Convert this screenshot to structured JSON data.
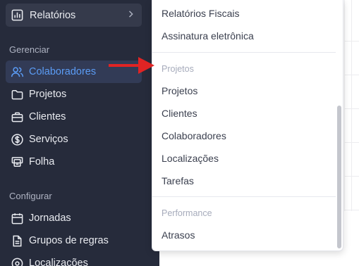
{
  "sidebar": {
    "reports_label": "Relatórios",
    "sections": {
      "manage": "Gerenciar",
      "configure": "Configurar"
    },
    "items": [
      {
        "label": "Colaboradores",
        "icon": "users-icon",
        "active": true
      },
      {
        "label": "Projetos",
        "icon": "folder-icon",
        "active": false
      },
      {
        "label": "Clientes",
        "icon": "briefcase-icon",
        "active": false
      },
      {
        "label": "Serviços",
        "icon": "dollar-circle-icon",
        "active": false
      },
      {
        "label": "Folha",
        "icon": "payroll-icon",
        "active": false
      },
      {
        "label": "Jornadas",
        "icon": "calendar-icon",
        "active": false
      },
      {
        "label": "Grupos de regras",
        "icon": "rules-document-icon",
        "active": false
      },
      {
        "label": "Localizações",
        "icon": "location-icon",
        "active": false
      }
    ]
  },
  "menu": {
    "top_items": [
      "Relatórios Fiscais",
      "Assinatura eletrônica"
    ],
    "groups": [
      {
        "title": "Projetos",
        "items": [
          "Projetos",
          "Clientes",
          "Colaboradores",
          "Localizações",
          "Tarefas"
        ]
      },
      {
        "title": "Performance",
        "items": [
          "Atrasos"
        ]
      }
    ]
  },
  "colors": {
    "sidebar_bg": "#262b3b",
    "active_accent": "#5b9cf5",
    "arrow": "#e02424"
  }
}
